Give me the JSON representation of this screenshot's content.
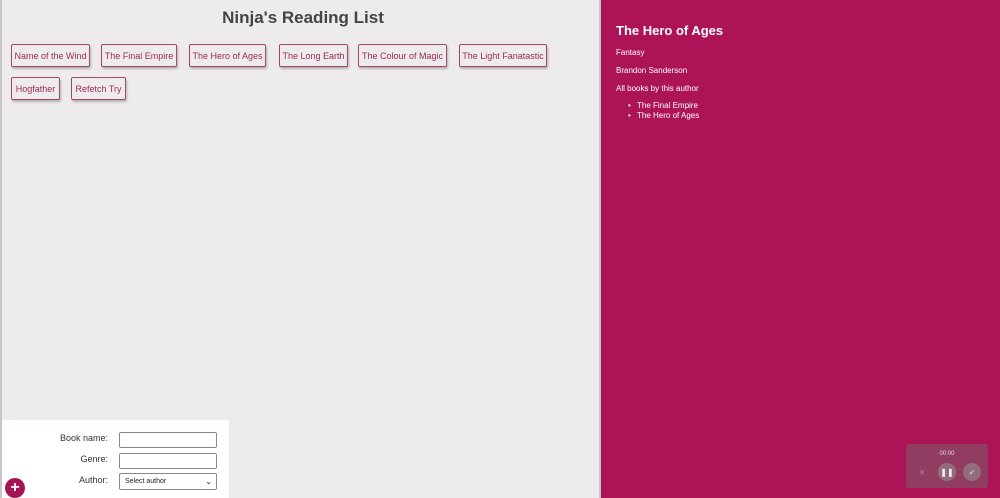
{
  "main": {
    "title": "Ninja's Reading List",
    "books": [
      {
        "label": "Name of the Wind"
      },
      {
        "label": "The Final Empire"
      },
      {
        "label": "The Hero of Ages"
      },
      {
        "label": "The Long Earth"
      },
      {
        "label": "The Colour of Magic"
      },
      {
        "label": "The Light Fanatastic"
      },
      {
        "label": "Hogfather"
      },
      {
        "label": "Refetch Try"
      }
    ]
  },
  "form": {
    "book_name_label": "Book name:",
    "genre_label": "Genre:",
    "author_label": "Author:",
    "author_selected": "Select author",
    "add_icon": "+"
  },
  "details": {
    "title": "The Hero of Ages",
    "genre": "Fantasy",
    "author": "Brandon Sanderson",
    "all_books_heading": "All books by this author",
    "author_books": [
      "The Final Empire",
      "The Hero of Ages"
    ]
  },
  "recorder": {
    "time": "00:00",
    "close_icon": "✕",
    "pause_icon": "❚❚",
    "check_icon": "✓"
  },
  "colors": {
    "accent": "#ad1457",
    "book_text": "#9c2a55"
  }
}
